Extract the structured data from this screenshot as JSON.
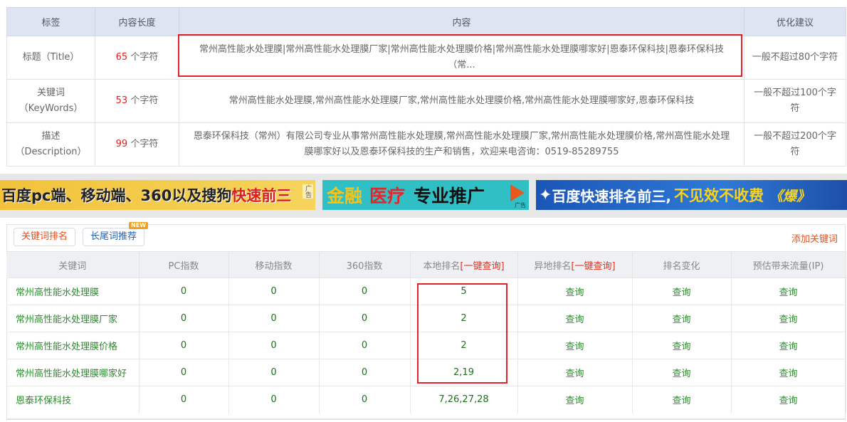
{
  "meta_table": {
    "headers": {
      "tag": "标签",
      "length": "内容长度",
      "content": "内容",
      "advice": "优化建议"
    },
    "rows": [
      {
        "label": "标题（Title）",
        "length_num": "65",
        "length_unit": " 个字符",
        "content": "常州高性能水处理膜|常州高性能水处理膜厂家|常州高性能水处理膜价格|常州高性能水处理膜哪家好|恩泰环保科技|恩泰环保科技（常...",
        "advice": "一般不超过80个字符"
      },
      {
        "label": "关键词（KeyWords）",
        "length_num": "53",
        "length_unit": " 个字符",
        "content": "常州高性能水处理膜,常州高性能水处理膜厂家,常州高性能水处理膜价格,常州高性能水处理膜哪家好,恩泰环保科技",
        "advice": "一般不超过100个字符"
      },
      {
        "label": "描述（Description）",
        "length_num": "99",
        "length_unit": " 个字符",
        "content": "恩泰环保科技（常州）有限公司专业从事常州高性能水处理膜,常州高性能水处理膜厂家,常州高性能水处理膜价格,常州高性能水处理膜哪家好以及恩泰环保科技的生产和销售，欢迎来电咨询：0519-85289755",
        "advice": "一般不超过200个字符"
      }
    ]
  },
  "ads": {
    "ad1": {
      "text_a": "百度pc端、移动端、360以及搜狗",
      "text_b": "快速前三",
      "tag": "广告"
    },
    "ad2": {
      "s1": "金融",
      "s2": "医疗",
      "s3": "专业推广",
      "tag": "广告"
    },
    "ad3": {
      "spark": "✦",
      "u1": "百度快速排名前三,",
      "u2": "不见效不收费",
      "u3": "《爆》"
    }
  },
  "ranking": {
    "tabs": {
      "active": "关键词排名",
      "other": "长尾词推荐",
      "new_badge": "NEW"
    },
    "add_keyword": "添加关键词",
    "headers": {
      "keyword": "关键词",
      "pc": "PC指数",
      "mobile": "移动指数",
      "idx360": "360指数",
      "local_prefix": "本地排名",
      "local_query": "[一键查询]",
      "remote_prefix": "异地排名",
      "remote_query": "[一键查询]",
      "change": "排名变化",
      "traffic": "预估带来流量(IP)"
    },
    "rows": [
      {
        "keyword": "常州高性能水处理膜",
        "pc": "0",
        "mobile": "0",
        "idx360": "0",
        "local": "5",
        "remote": "查询",
        "change": "查询",
        "traffic": "查询"
      },
      {
        "keyword": "常州高性能水处理膜厂家",
        "pc": "0",
        "mobile": "0",
        "idx360": "0",
        "local": "2",
        "remote": "查询",
        "change": "查询",
        "traffic": "查询"
      },
      {
        "keyword": "常州高性能水处理膜价格",
        "pc": "0",
        "mobile": "0",
        "idx360": "0",
        "local": "2",
        "remote": "查询",
        "change": "查询",
        "traffic": "查询"
      },
      {
        "keyword": "常州高性能水处理膜哪家好",
        "pc": "0",
        "mobile": "0",
        "idx360": "0",
        "local": "2,19",
        "remote": "查询",
        "change": "查询",
        "traffic": "查询"
      },
      {
        "keyword": "恩泰环保科技",
        "pc": "0",
        "mobile": "0",
        "idx360": "0",
        "local": "7,26,27,28",
        "remote": "查询",
        "change": "查询",
        "traffic": "查询"
      }
    ]
  },
  "colors": {
    "highlight_red": "#e0242b",
    "accent_orange": "#e5501c",
    "keyword_green": "#2e8b2e"
  }
}
